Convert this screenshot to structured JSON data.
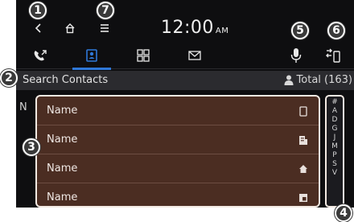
{
  "status_bar": {
    "clock": "12:00",
    "ampm": "AM",
    "icons": [
      "back-icon",
      "home-icon",
      "menu-icon",
      "microphone-icon",
      "phone-switch-icon"
    ]
  },
  "tabs": [
    {
      "icon": "call-history-icon",
      "active": false
    },
    {
      "icon": "contacts-icon",
      "active": true
    },
    {
      "icon": "dial-pad-icon",
      "active": false
    },
    {
      "icon": "message-icon",
      "active": false
    }
  ],
  "search": {
    "label": "Search Contacts",
    "total_label": "Total (163)"
  },
  "contacts": {
    "section_letter": "N",
    "rows": [
      {
        "name": "Name",
        "type_icon": "mobile-phone-icon"
      },
      {
        "name": "Name",
        "type_icon": "office-icon"
      },
      {
        "name": "Name",
        "type_icon": "home-phone-icon"
      },
      {
        "name": "Name",
        "type_icon": "other-phone-icon"
      }
    ]
  },
  "index_letters": [
    "#",
    "A",
    "D",
    "G",
    "J",
    "M",
    "P",
    "S",
    "V"
  ],
  "callouts": [
    "1",
    "2",
    "3",
    "4",
    "5",
    "6",
    "7"
  ],
  "colors": {
    "background": "#0e0e10",
    "accent": "#2f78d8",
    "list_highlight": "#4b2d22",
    "callout_badge": "#3a3a3a"
  }
}
